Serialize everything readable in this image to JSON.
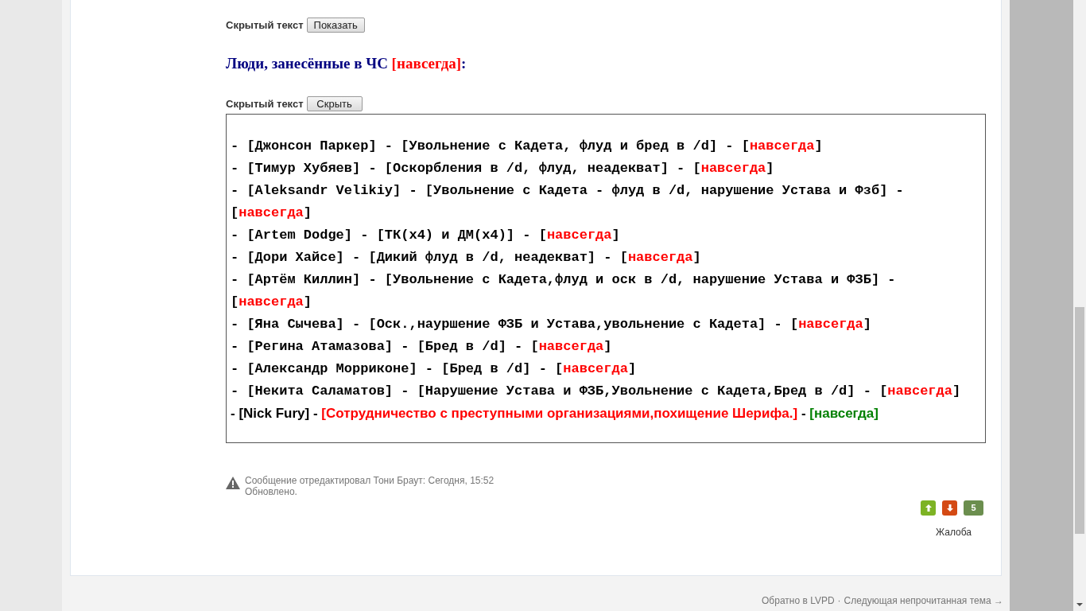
{
  "spoilers": [
    {
      "label": "Скрытый текст",
      "button": "Показать"
    },
    {
      "label": "Скрытый текст",
      "button": "Скрыть"
    }
  ],
  "heading": [
    {
      "text": "Люди, занесённые в ЧС ",
      "color": "#000080"
    },
    {
      "text": "[навсегда]",
      "color": "#ff0000"
    },
    {
      "text": ":",
      "color": "#000080"
    }
  ],
  "entries": [
    {
      "kind": "mono",
      "segments": [
        {
          "text": "- [Джонсон Паркер] - [Увольнение с Кадета, флуд и бред в /d] - [",
          "color": "#000000"
        },
        {
          "text": "навсегда",
          "color": "#ff0000"
        },
        {
          "text": "]",
          "color": "#000000"
        }
      ]
    },
    {
      "kind": "mono",
      "segments": [
        {
          "text": "- [Тимур Хубяев] - [Оскорбления в /d, флуд, неадекват] - [",
          "color": "#000000"
        },
        {
          "text": "навсегда",
          "color": "#ff0000"
        },
        {
          "text": "]",
          "color": "#000000"
        }
      ]
    },
    {
      "kind": "mono",
      "segments": [
        {
          "text": "- [Aleksandr Velikiy] - [Увольнение с Кадета - флуд в /d, нарушение Устава и Фзб] - [",
          "color": "#000000"
        },
        {
          "text": "навсегда",
          "color": "#ff0000"
        },
        {
          "text": "]",
          "color": "#000000"
        }
      ]
    },
    {
      "kind": "mono",
      "segments": [
        {
          "text": "- [Artem Dodge] - [ТК(x4) и ДМ(x4)] - [",
          "color": "#000000"
        },
        {
          "text": "навсегда",
          "color": "#ff0000"
        },
        {
          "text": "]",
          "color": "#000000"
        }
      ]
    },
    {
      "kind": "mono",
      "segments": [
        {
          "text": "- [Дори Хайсе] - [Дикий флуд в /d, неадекват] - [",
          "color": "#000000"
        },
        {
          "text": "навсегда",
          "color": "#ff0000"
        },
        {
          "text": "]",
          "color": "#000000"
        }
      ]
    },
    {
      "kind": "mono",
      "segments": [
        {
          "text": "- [Артём Киллин] - [Увольнение с Кадета,флуд и оск в /d, нарушение Устава и ФЗБ] - [",
          "color": "#000000"
        },
        {
          "text": "навсегда",
          "color": "#ff0000"
        },
        {
          "text": "]",
          "color": "#000000"
        }
      ]
    },
    {
      "kind": "mono",
      "segments": [
        {
          "text": "- [Яна Сычева] - [Оск.,науршение ФЗБ и Устава,увольнение с Кадета] - [",
          "color": "#000000"
        },
        {
          "text": "навсегда",
          "color": "#ff0000"
        },
        {
          "text": "]",
          "color": "#000000"
        }
      ]
    },
    {
      "kind": "mono",
      "segments": [
        {
          "text": "- [Регина Атамазова] - [Бред в /d] - [",
          "color": "#000000"
        },
        {
          "text": "навсегда",
          "color": "#ff0000"
        },
        {
          "text": "]",
          "color": "#000000"
        }
      ]
    },
    {
      "kind": "mono",
      "segments": [
        {
          "text": "- [Александр Морриконе] - [Бред в /d] - [",
          "color": "#000000"
        },
        {
          "text": "навсегда",
          "color": "#ff0000"
        },
        {
          "text": "]",
          "color": "#000000"
        }
      ]
    },
    {
      "kind": "mono",
      "segments": [
        {
          "text": "- [Некита Саламатов] - [Нарушение Устава и ФЗБ,Увольнение с Кадета,Бред в /d] - [",
          "color": "#000000"
        },
        {
          "text": "навсегда",
          "color": "#ff0000"
        },
        {
          "text": "]",
          "color": "#000000"
        }
      ]
    },
    {
      "kind": "sans",
      "segments": [
        {
          "text": "- [Nick Fury] - ",
          "color": "#000000"
        },
        {
          "text": "[Сотрудничество с преступными организациями,похищение Шерифа.]",
          "color": "#ff0000"
        },
        {
          "text": " - ",
          "color": "#000000"
        },
        {
          "text": "[навсегда]",
          "color": "#008000"
        }
      ]
    }
  ],
  "edit_note": {
    "text": "Сообщение отредактировал Тони Браут: Сегодня, 15:52",
    "reason": "Обновлено."
  },
  "rating": {
    "score": "5"
  },
  "report": "Жалоба",
  "footer": {
    "back": "Обратно в LVPD",
    "separator": "·",
    "next": "Следующая непрочитанная тема →"
  }
}
